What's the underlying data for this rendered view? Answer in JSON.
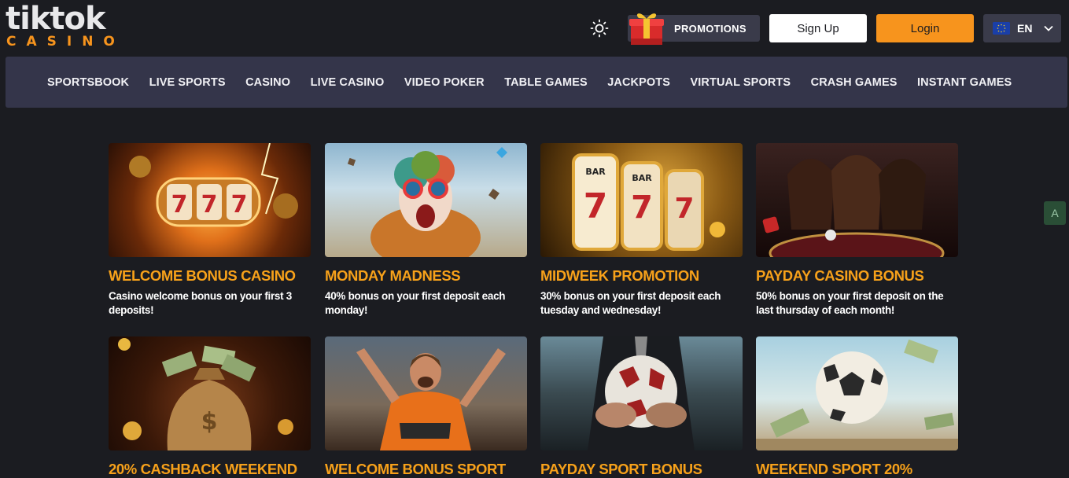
{
  "brand": {
    "logo_top": "tiktok",
    "logo_bottom": "CASINO"
  },
  "header": {
    "promotions_label": "PROMOTIONS",
    "signup_label": "Sign Up",
    "login_label": "Login",
    "language_code": "EN"
  },
  "nav": {
    "items": [
      "SPORTSBOOK",
      "LIVE SPORTS",
      "CASINO",
      "LIVE CASINO",
      "VIDEO POKER",
      "TABLE GAMES",
      "JACKPOTS",
      "VIRTUAL SPORTS",
      "CRASH GAMES",
      "INSTANT GAMES"
    ]
  },
  "promos": [
    {
      "title": "WELCOME BONUS CASINO",
      "desc": "Casino welcome bonus on your first 3 deposits!",
      "image": "slot-reels-777"
    },
    {
      "title": "MONDAY MADNESS",
      "desc": "40% bonus on your first deposit each monday!",
      "image": "clown-with-sunglasses"
    },
    {
      "title": "MIDWEEK PROMOTION",
      "desc": "30% bonus on your first deposit each tuesday and wednesday!",
      "image": "golden-slot-machine"
    },
    {
      "title": "PAYDAY CASINO BONUS",
      "desc": "50% bonus on your first deposit on the last thursday of each month!",
      "image": "roulette-table-women"
    },
    {
      "title": "20% CASHBACK WEEKEND",
      "desc": "",
      "image": "money-bag"
    },
    {
      "title": "WELCOME BONUS SPORT",
      "desc": "",
      "image": "cheering-football-fan"
    },
    {
      "title": "PAYDAY SPORT BONUS",
      "desc": "",
      "image": "soccer-ball-in-hands"
    },
    {
      "title": "WEEKEND SPORT 20%",
      "desc": "",
      "image": "soccer-ball-with-cash"
    }
  ],
  "colors": {
    "background": "#1b1c21",
    "nav_bg": "#34354a",
    "accent": "#f7941d",
    "title": "#f7a11a"
  }
}
